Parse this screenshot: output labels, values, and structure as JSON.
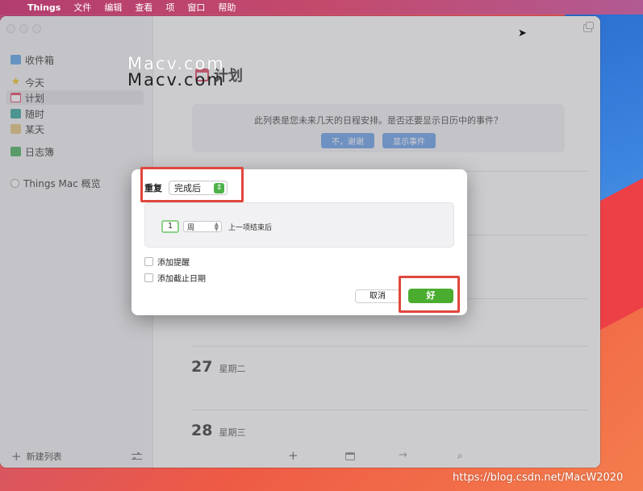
{
  "menubar": {
    "apple_icon": "apple-icon",
    "items": [
      "Things",
      "文件",
      "编辑",
      "查看",
      "项",
      "窗口",
      "帮助"
    ]
  },
  "sidebar": {
    "items": [
      {
        "label": "收件箱",
        "icon": "inbox-icon"
      },
      {
        "label": "今天",
        "icon": "star-icon"
      },
      {
        "label": "计划",
        "icon": "calendar-icon",
        "selected": true
      },
      {
        "label": "随时",
        "icon": "layers-icon"
      },
      {
        "label": "某天",
        "icon": "archive-box-icon"
      },
      {
        "label": "日志簿",
        "icon": "logbook-icon"
      },
      {
        "label": "Things Mac 概览",
        "icon": "circle-icon"
      }
    ],
    "footer": {
      "new_list_label": "新建列表",
      "settings_icon": "sliders-icon"
    }
  },
  "main": {
    "title": "计划",
    "watermark": [
      "Macv.com",
      "Macv.com"
    ],
    "banner": {
      "text": "此列表是您未来几天的日程安排。是否还要显示日历中的事件？",
      "no_button": "不，谢谢",
      "show_button": "显示事件"
    },
    "days": [
      {
        "num": "27",
        "name": "星期二"
      },
      {
        "num": "28",
        "name": "星期三"
      }
    ]
  },
  "modal": {
    "repeat_label": "重复",
    "repeat_mode": "完成后",
    "interval_value": "1",
    "interval_unit": "周",
    "after_text": "上一项结束后",
    "add_reminder": "添加提醒",
    "add_deadline": "添加截止日期",
    "cancel_label": "取消",
    "ok_label": "好"
  },
  "colors": {
    "annotation_red": "#e0473d",
    "ok_green": "#4aad2f",
    "calendar_red": "#e0425d"
  },
  "url_watermark": "https://blog.csdn.net/MacW2020"
}
